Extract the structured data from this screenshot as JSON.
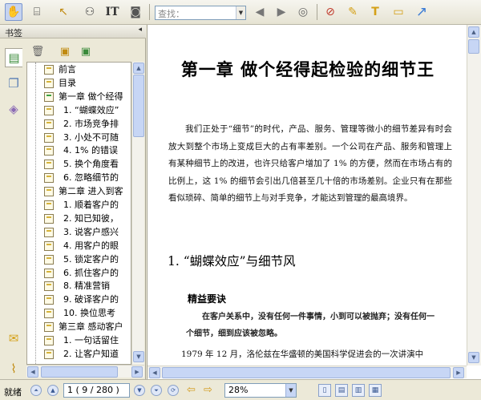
{
  "toolbar": {
    "search_placeholder": "查找：",
    "icons": [
      "hand-tool",
      "select-text",
      "pointer",
      "binoculars",
      "text-select",
      "snapshot",
      "prev-result",
      "next-result",
      "search-options",
      "attachment",
      "note",
      "text-box",
      "comment",
      "arrow"
    ]
  },
  "panel": {
    "title": "书签",
    "collapse_glyph": "◂",
    "bookmarks": [
      {
        "label": "前言",
        "level": 0
      },
      {
        "label": "目录",
        "level": 0
      },
      {
        "label": "第一章  做个经得",
        "level": 0,
        "selected": true
      },
      {
        "label": "1. “蝴蝶效应”",
        "level": 1
      },
      {
        "label": "2. 市场竞争排",
        "level": 1
      },
      {
        "label": "3. 小处不可随",
        "level": 1
      },
      {
        "label": "4. 1% 的错误",
        "level": 1
      },
      {
        "label": "5. 换个角度看",
        "level": 1
      },
      {
        "label": "6. 忽略细节的",
        "level": 1
      },
      {
        "label": "第二章  进入到客",
        "level": 0
      },
      {
        "label": "1. 顺着客户的",
        "level": 1
      },
      {
        "label": "2. 知已知彼，",
        "level": 1
      },
      {
        "label": "3. 说客户感兴",
        "level": 1
      },
      {
        "label": "4. 用客户的眼",
        "level": 1
      },
      {
        "label": "5. 锁定客户的",
        "level": 1
      },
      {
        "label": "6. 抓住客户的",
        "level": 1
      },
      {
        "label": "8. 精准营销",
        "level": 1
      },
      {
        "label": "9. 破译客户的",
        "level": 1
      },
      {
        "label": "10. 换位思考",
        "level": 1
      },
      {
        "label": "第三章  感动客户",
        "level": 0
      },
      {
        "label": "1. 一句话留住",
        "level": 1
      },
      {
        "label": "2. 让客户知道",
        "level": 1
      }
    ]
  },
  "document": {
    "chapter_title": "第一章   做个经得起检验的细节王",
    "paragraph": "我们正处于“细节”的时代，产品、服务、管理等微小的细节差异有时会放大到整个市场上变成巨大的占有率差别。一个公司在产品、服务和管理上有某种细节上的改进，也许只给客户增加了 1% 的方便，然而在市场占有的比例上，这 1% 的细节会引出几倍甚至几十倍的市场差别。企业只有在那些看似琐碎、简单的细节上与对手竞争，才能达到管理的最高境界。",
    "section_title": "1. “蝴蝶效应”与细节风",
    "tip_heading": "精益要诀",
    "tip_text": "在客户关系中，没有任何一件事情，小到可以被抛弃；没有任何一个细节，细到应该被忽略。",
    "paragraph2": "1979 年 12 月，洛伦兹在华盛顿的美国科学促进会的一次讲演中"
  },
  "statusbar": {
    "status": "就绪",
    "page_indicator": "1  ( 9 / 280 )",
    "zoom": "28%"
  }
}
